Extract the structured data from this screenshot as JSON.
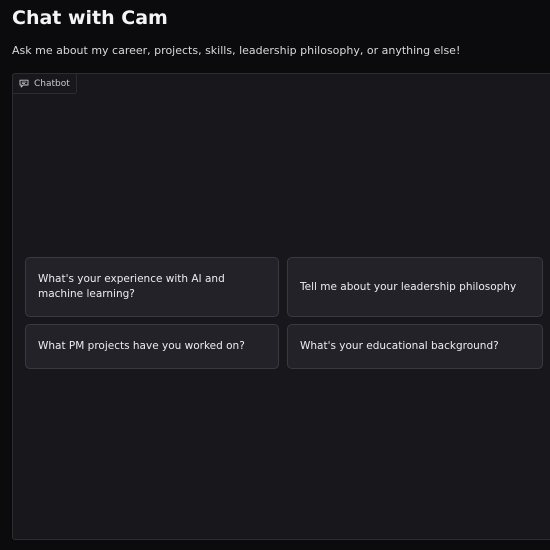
{
  "header": {
    "title": "Chat with Cam",
    "subtitle": "Ask me about my career, projects, skills, leadership philosophy, or anything else!"
  },
  "chatbot": {
    "tab_label": "Chatbot",
    "tab_icon": "chat-bubble-icon",
    "examples": [
      {
        "text": "What's your experience with AI and machine learning?"
      },
      {
        "text": "Tell me about your leadership philosophy"
      },
      {
        "text": "What PM projects have you worked on?"
      },
      {
        "text": "What's your educational background?"
      }
    ]
  },
  "colors": {
    "background": "#0b0b0d",
    "panel": "#18171c",
    "card": "#232228",
    "border": "#3a3940"
  }
}
